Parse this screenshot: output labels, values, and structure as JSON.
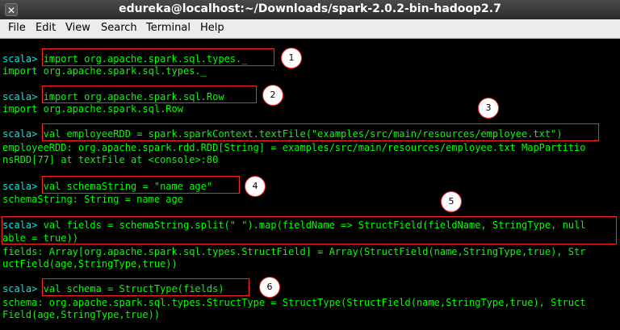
{
  "window": {
    "title": "edureka@localhost:~/Downloads/spark-2.0.2-bin-hadoop2.7"
  },
  "menu": [
    "File",
    "Edit",
    "View",
    "Search",
    "Terminal",
    "Help"
  ],
  "prompt": "scala>",
  "lines": [
    {
      "cmd": "import org.apache.spark.sql.types._"
    },
    {
      "out": "import org.apache.spark.sql.types._"
    },
    {
      "cmd": "import org.apache.spark.sql.Row"
    },
    {
      "out": "import org.apache.spark.sql.Row"
    },
    {
      "cmd": "val employeeRDD = spark.sparkContext.textFile(\"examples/src/main/resources/employee.txt\")"
    },
    {
      "out": "employeeRDD: org.apache.spark.rdd.RDD[String] = examples/src/main/resources/employee.txt MapPartitio"
    },
    {
      "out": "nsRDD[77] at textFile at <console>:80"
    },
    {
      "cmd": "val schemaString = \"name age\""
    },
    {
      "out": "schemaString: String = name age"
    },
    {
      "cmd": "val fields = schemaString.split(\" \").map(fieldName => StructField(fieldName, StringType, null"
    },
    {
      "out": "able = true))"
    },
    {
      "out": "fields: Array[org.apache.spark.sql.types.StructField] = Array(StructField(name,StringType,true), Str"
    },
    {
      "out": "uctField(age,StringType,true))"
    },
    {
      "cmd": "val schema = StructType(fields)"
    },
    {
      "out": "schema: org.apache.spark.sql.types.StructType = StructType(StructField(name,StringType,true), Struct"
    },
    {
      "out": "Field(age,StringType,true))"
    }
  ],
  "annotations": [
    "1",
    "2",
    "3",
    "4",
    "5",
    "6"
  ],
  "colors": {
    "prompt": "#00e8e8",
    "text": "#00ff00",
    "highlight_box": "#ff2222",
    "background": "#000000"
  },
  "icons": {
    "close": "close-icon"
  }
}
